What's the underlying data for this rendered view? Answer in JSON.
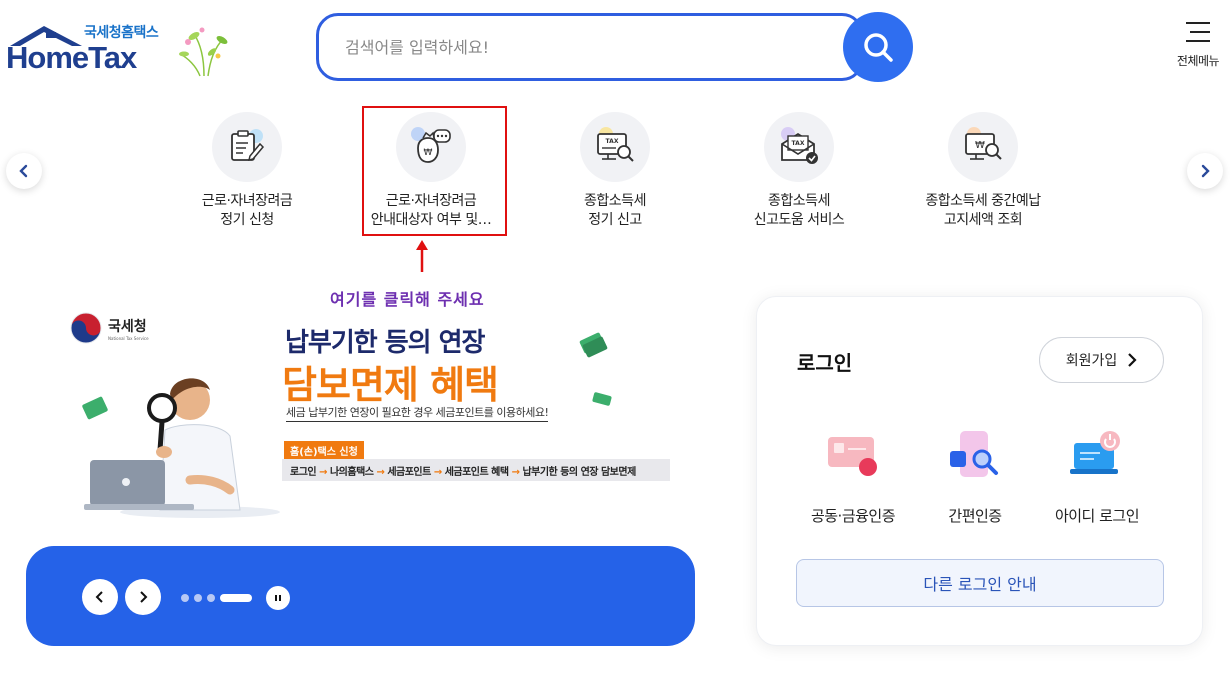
{
  "header": {
    "logo_sub": "국세청홈택스",
    "logo_main": "HomeTax",
    "search_placeholder": "검색어를 입력하세요!",
    "menu_label": "전체메뉴"
  },
  "shortcuts": [
    {
      "line1": "근로·자녀장려금",
      "line2": "정기 신청",
      "icon": "document-pen-icon"
    },
    {
      "line1": "근로·자녀장려금",
      "line2": "안내대상자 여부 및…",
      "icon": "money-bag-chat-icon"
    },
    {
      "line1": "종합소득세",
      "line2": "정기 신고",
      "icon": "tax-monitor-search-icon"
    },
    {
      "line1": "종합소득세",
      "line2": "신고도움 서비스",
      "icon": "tax-envelope-check-icon"
    },
    {
      "line1": "종합소득세 중간예납",
      "line2": "고지세액 조회",
      "icon": "won-monitor-search-icon"
    }
  ],
  "annotation": {
    "hint": "여기를 클릭해 주세요",
    "color": "#e01010"
  },
  "banner": {
    "agency": "국세청",
    "agency_en": "National Tax Service",
    "title1": "납부기한 등의 연장",
    "title2": "담보면제 혜택",
    "desc": "세금 납부기한 연장이 필요한 경우 세금포인트를 이용하세요!",
    "tag": "홈(손)택스 신청",
    "path": [
      "로그인",
      "나의홈택스",
      "세금포인트",
      "세금포인트 혜택",
      "납부기한 등의 연장 담보면제"
    ]
  },
  "login": {
    "title": "로그인",
    "signup": "회원가입",
    "options": [
      {
        "label": "공동·금융인증",
        "icon": "certificate-card-icon"
      },
      {
        "label": "간편인증",
        "icon": "phone-search-icon"
      },
      {
        "label": "아이디 로그인",
        "icon": "laptop-power-icon"
      }
    ],
    "other": "다른 로그인 안내"
  },
  "colors": {
    "brand_blue": "#2f6ef0",
    "banner_orange": "#f07a10",
    "slider_blue": "#2562e8",
    "hint_purple": "#6d2fb0"
  }
}
